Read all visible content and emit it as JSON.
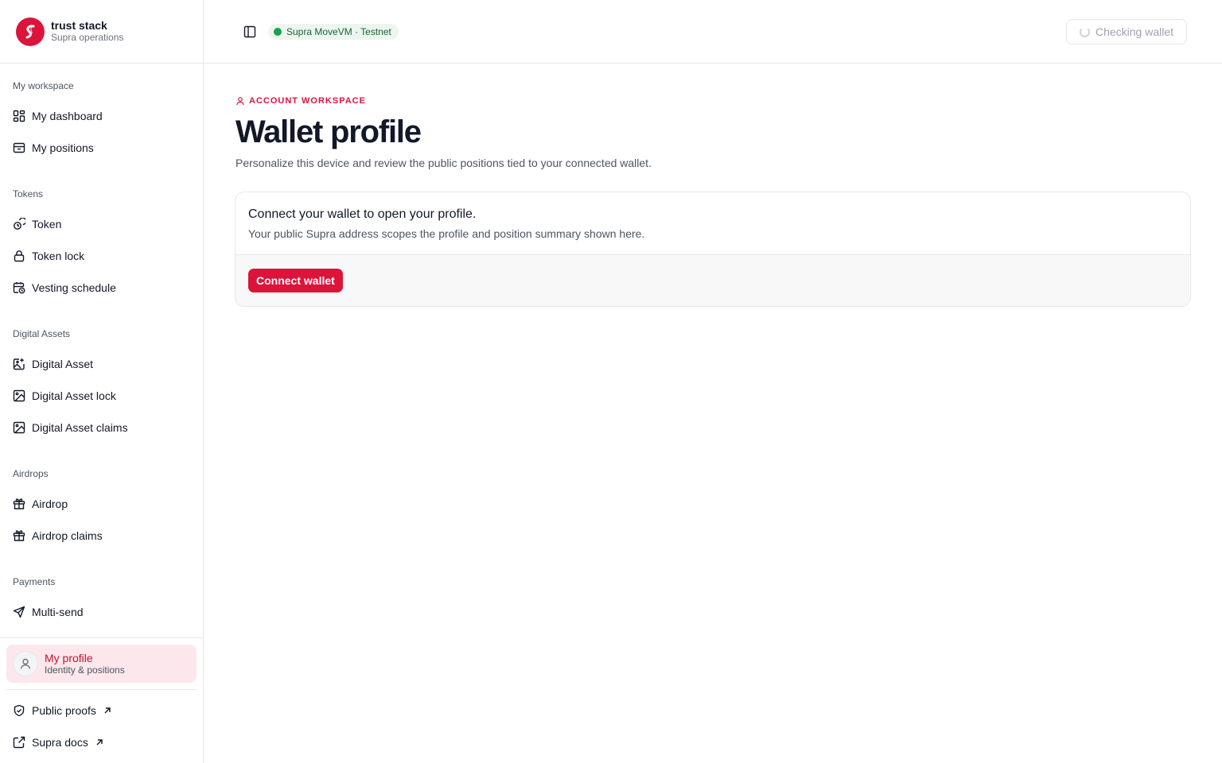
{
  "brand": {
    "name": "trust stack",
    "subtitle": "Supra operations",
    "color": "#dc143c"
  },
  "sidebar": {
    "sections": [
      {
        "label": "My workspace",
        "items": [
          {
            "label": "My dashboard",
            "icon": "dashboard-grid-icon"
          },
          {
            "label": "My positions",
            "icon": "inbox-icon"
          }
        ]
      },
      {
        "label": "Tokens",
        "items": [
          {
            "label": "Token",
            "icon": "coins-icon"
          },
          {
            "label": "Token lock",
            "icon": "lock-icon"
          },
          {
            "label": "Vesting schedule",
            "icon": "calendar-clock-icon"
          }
        ]
      },
      {
        "label": "Digital Assets",
        "items": [
          {
            "label": "Digital Asset",
            "icon": "image-plus-icon"
          },
          {
            "label": "Digital Asset lock",
            "icon": "image-icon"
          },
          {
            "label": "Digital Asset claims",
            "icon": "image-icon"
          }
        ]
      },
      {
        "label": "Airdrops",
        "items": [
          {
            "label": "Airdrop",
            "icon": "gift-icon"
          },
          {
            "label": "Airdrop claims",
            "icon": "gift-icon"
          }
        ]
      },
      {
        "label": "Payments",
        "items": [
          {
            "label": "Multi-send",
            "icon": "send-icon"
          }
        ]
      }
    ],
    "profile": {
      "title": "My profile",
      "subtitle": "Identity & positions"
    },
    "footer_links": [
      {
        "label": "Public proofs",
        "icon": "shield-check-icon"
      },
      {
        "label": "Supra docs",
        "icon": "external-link-icon"
      }
    ]
  },
  "header": {
    "network": "Supra MoveVM · Testnet",
    "wallet_status": "Checking wallet"
  },
  "main": {
    "eyebrow": "ACCOUNT WORKSPACE",
    "title": "Wallet profile",
    "description": "Personalize this device and review the public positions tied to your connected wallet.",
    "card": {
      "title": "Connect your wallet to open your profile.",
      "subtitle": "Your public Supra address scopes the profile and position summary shown here.",
      "button": "Connect wallet"
    }
  },
  "colors": {
    "accent": "#dc143c",
    "network_green": "#16a34a",
    "profile_highlight": "#fce7ec"
  }
}
